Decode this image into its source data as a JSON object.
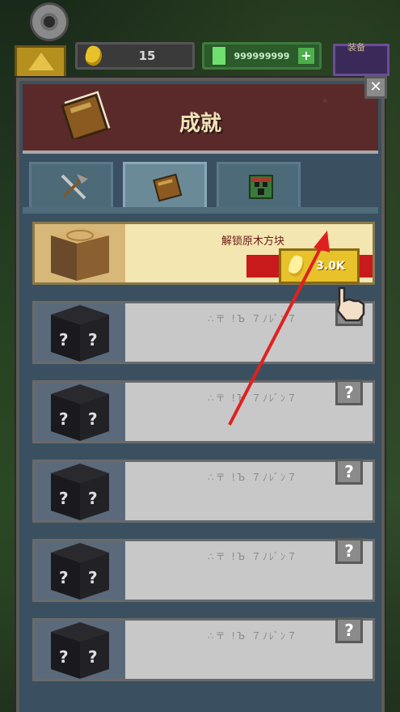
{
  "hud": {
    "gold_value": "15",
    "gem_value": "999999999",
    "gem_plus": "+",
    "equip_label": "装备"
  },
  "panel": {
    "title": "成就",
    "close_label": "✕"
  },
  "tabs": [
    {
      "name": "tools",
      "icon": "pickaxe-sword-icon",
      "active": false
    },
    {
      "name": "book",
      "icon": "book-icon",
      "active": true
    },
    {
      "name": "block",
      "icon": "creeper-block-icon",
      "active": false
    }
  ],
  "achievements": [
    {
      "name": "解锁原木方块",
      "locked": false,
      "icon": "wood-log-block-icon",
      "reward": "3.0K"
    },
    {
      "name": "∴〒 !Ъ ７ﾉﾚﾞﾝ７",
      "locked": true,
      "icon": "mystery-block-icon",
      "hint": "?"
    },
    {
      "name": "∴〒 !Ъ ７ﾉﾚﾞﾝ７",
      "locked": true,
      "icon": "mystery-block-icon",
      "hint": "?"
    },
    {
      "name": "∴〒 !Ъ ７ﾉﾚﾞﾝ７",
      "locked": true,
      "icon": "mystery-block-icon",
      "hint": "?"
    },
    {
      "name": "∴〒 !Ъ ７ﾉﾚﾞﾝ７",
      "locked": true,
      "icon": "mystery-block-icon",
      "hint": "?"
    },
    {
      "name": "∴〒 !Ъ ７ﾉﾚﾞﾝ７",
      "locked": true,
      "icon": "mystery-block-icon",
      "hint": "?"
    }
  ],
  "colors": {
    "accent_gold": "#e8c22a",
    "ribbon_red": "#c81a1a",
    "title": "#f3e2b8",
    "arrow": "#e02020"
  }
}
